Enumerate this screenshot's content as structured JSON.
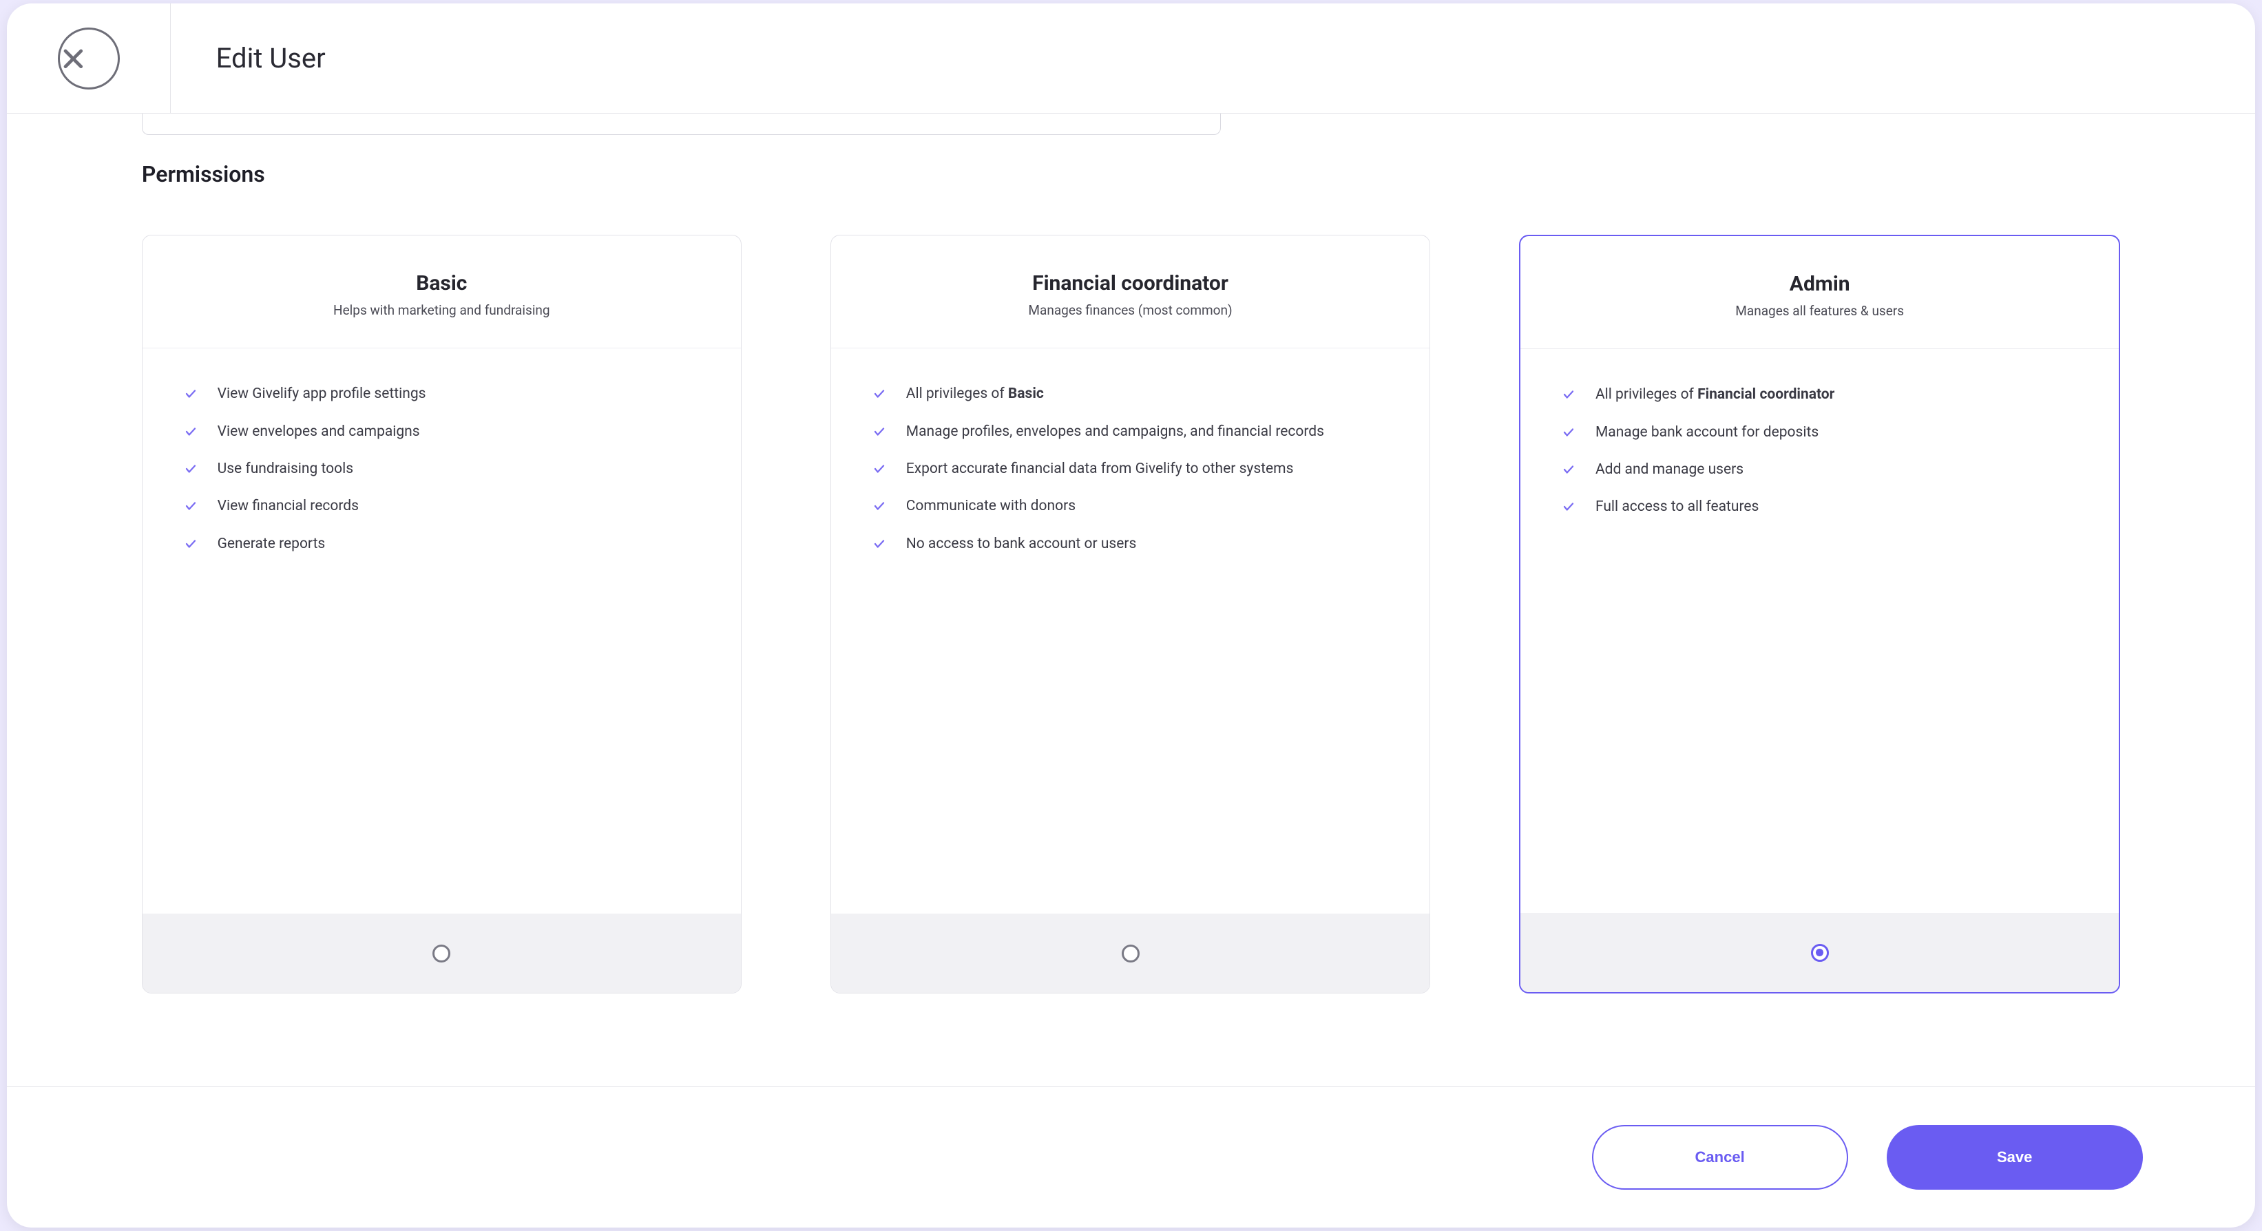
{
  "header": {
    "title": "Edit User"
  },
  "permissions": {
    "section_title": "Permissions",
    "selected_index": 2,
    "cards": [
      {
        "title": "Basic",
        "subtitle": "Helps with marketing and fundraising",
        "features": [
          {
            "prefix": "",
            "bold": "",
            "text": "View Givelify app profile settings"
          },
          {
            "prefix": "",
            "bold": "",
            "text": "View envelopes and campaigns"
          },
          {
            "prefix": "",
            "bold": "",
            "text": "Use fundraising tools"
          },
          {
            "prefix": "",
            "bold": "",
            "text": "View financial records"
          },
          {
            "prefix": "",
            "bold": "",
            "text": "Generate reports"
          }
        ]
      },
      {
        "title": "Financial coordinator",
        "subtitle": "Manages finances (most common)",
        "features": [
          {
            "prefix": "All privileges of ",
            "bold": "Basic",
            "text": ""
          },
          {
            "prefix": "",
            "bold": "",
            "text": "Manage profiles, envelopes and campaigns, and financial records"
          },
          {
            "prefix": "",
            "bold": "",
            "text": "Export accurate financial data from Givelify to other systems"
          },
          {
            "prefix": "",
            "bold": "",
            "text": "Communicate with donors"
          },
          {
            "prefix": "",
            "bold": "",
            "text": "No access to bank account or users"
          }
        ]
      },
      {
        "title": "Admin",
        "subtitle": "Manages all features & users",
        "features": [
          {
            "prefix": "All privileges of ",
            "bold": "Financial coordinator",
            "text": ""
          },
          {
            "prefix": "",
            "bold": "",
            "text": "Manage bank account for deposits"
          },
          {
            "prefix": "",
            "bold": "",
            "text": "Add and manage users"
          },
          {
            "prefix": "",
            "bold": "",
            "text": "Full access to all features"
          }
        ]
      }
    ]
  },
  "footer": {
    "cancel": "Cancel",
    "save": "Save"
  }
}
